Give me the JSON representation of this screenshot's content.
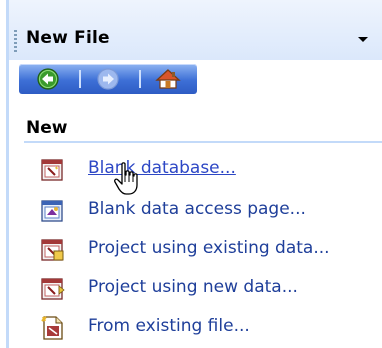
{
  "pane": {
    "title": "New File",
    "menu_icon": "chevron-down-icon"
  },
  "nav": {
    "back_icon": "back-arrow-icon",
    "forward_icon": "forward-arrow-icon",
    "home_icon": "home-icon"
  },
  "section": {
    "heading": "New"
  },
  "items": [
    {
      "label": "Blank database...",
      "icon": "blank-database-icon"
    },
    {
      "label": "Blank data access page...",
      "icon": "data-access-page-icon"
    },
    {
      "label": "Project using existing data...",
      "icon": "project-existing-data-icon"
    },
    {
      "label": "Project using new data...",
      "icon": "project-new-data-icon"
    },
    {
      "label": "From existing file...",
      "icon": "existing-file-icon"
    }
  ],
  "colors": {
    "link": "#1f3f9a",
    "header_bg": "#dbe8fb",
    "nav_bg": "#3d6fd6"
  }
}
